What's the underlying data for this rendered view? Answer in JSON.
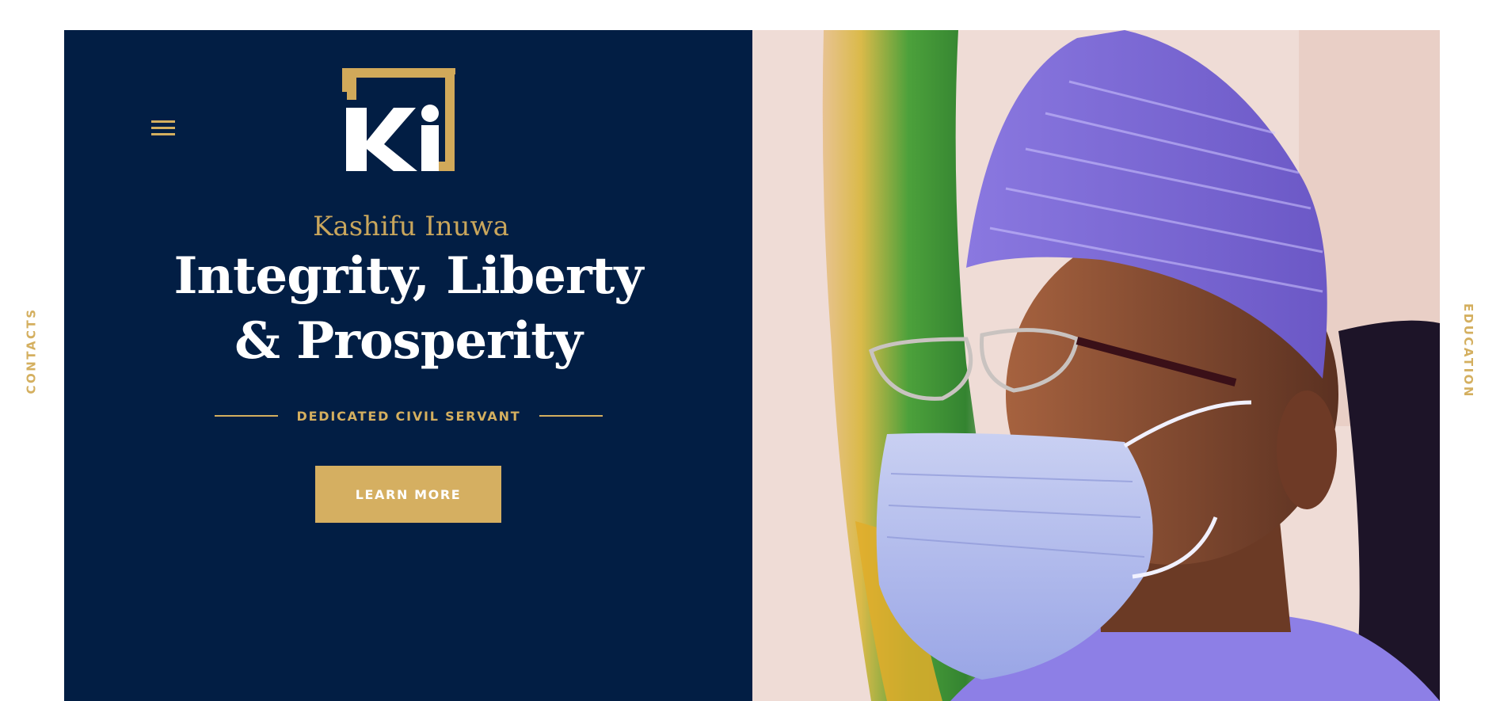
{
  "side_nav": {
    "left_label": "CONTACTS",
    "right_label": "EDUCATION"
  },
  "brand": {
    "monogram": "Ki",
    "name": "Kashifu Inuwa"
  },
  "hero": {
    "headline_line1": "Integrity, Liberty",
    "headline_line2": "& Prosperity",
    "tagline": "DEDICATED CIVIL SERVANT",
    "cta_label": "LEARN MORE"
  },
  "colors": {
    "navy": "#021e44",
    "gold": "#d4af5f",
    "white": "#ffffff"
  },
  "icons": {
    "menu": "hamburger-menu-icon"
  }
}
